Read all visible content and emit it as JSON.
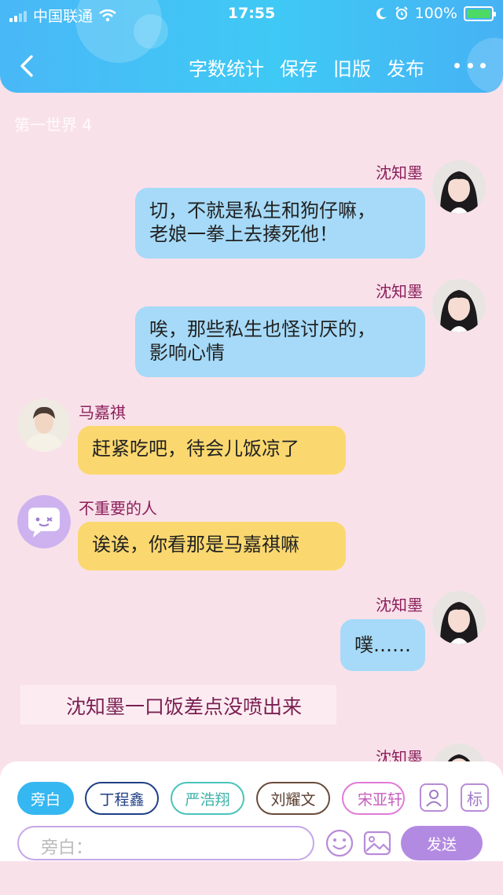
{
  "status": {
    "carrier": "中国联通",
    "time": "17:55",
    "battery": "100%"
  },
  "nav": {
    "actions": [
      "字数统计",
      "保存",
      "旧版",
      "发布"
    ]
  },
  "world_title": "第一世界 4",
  "messages": [
    {
      "name": "沈知墨",
      "text_lines": [
        "切，不就是私生和狗仔嘛，",
        "老娘一拳上去揍死他！"
      ]
    },
    {
      "name": "沈知墨",
      "text_lines": [
        "唉，那些私生也怪讨厌的，",
        "影响心情"
      ]
    },
    {
      "name": "马嘉祺",
      "text": "赶紧吃吧，待会儿饭凉了"
    },
    {
      "name": "不重要的人",
      "text": "诶诶，你看那是马嘉祺嘛"
    },
    {
      "name": "沈知墨",
      "text": "噗……"
    },
    {
      "name": "沈知墨"
    }
  ],
  "narration": "沈知墨一口饭差点没喷出来",
  "composer": {
    "chips": [
      "旁白",
      "丁程鑫",
      "严浩翔",
      "刘耀文",
      "宋亚轩"
    ],
    "mark_label": "标",
    "input_placeholder": "旁白：",
    "send_label": "发送"
  },
  "colors": {
    "header": "#49b8f6",
    "background": "#f9e1ea",
    "bubble_right": "#a6daf8",
    "bubble_left": "#fbd86f",
    "name": "#8b1f5a",
    "send": "#b38ae2",
    "chip_active": "#35b7f1"
  }
}
